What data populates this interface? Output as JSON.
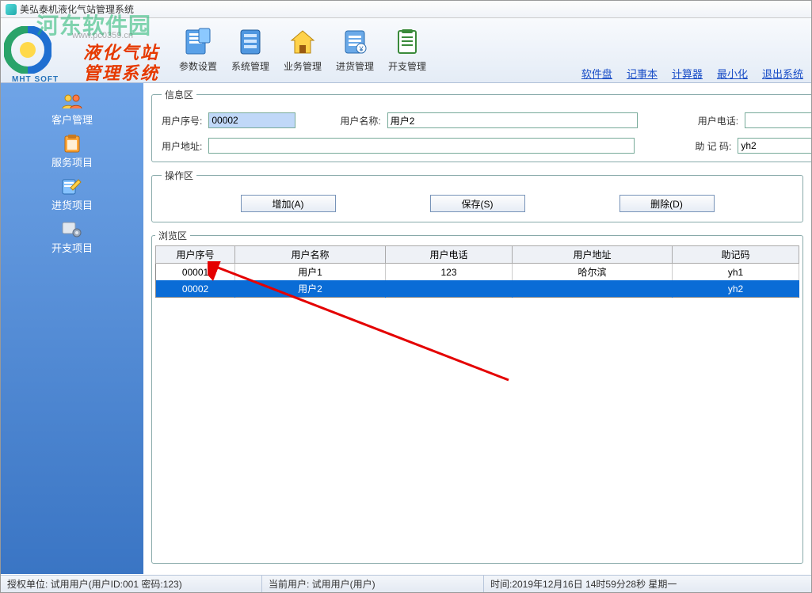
{
  "window": {
    "title": "美弘泰机液化气站管理系统"
  },
  "brand": {
    "line1": "液化气站",
    "line2": "管理系统",
    "mht": "MHT SOFT"
  },
  "watermark": {
    "big": "河东软件园",
    "url": "www.pc0359.cn"
  },
  "menu": [
    {
      "key": "params",
      "label": "参数设置"
    },
    {
      "key": "system",
      "label": "系统管理"
    },
    {
      "key": "biz",
      "label": "业务管理"
    },
    {
      "key": "stock",
      "label": "进货管理"
    },
    {
      "key": "expense",
      "label": "开支管理"
    }
  ],
  "links": [
    {
      "key": "disk",
      "label": "软件盘"
    },
    {
      "key": "note",
      "label": "记事本"
    },
    {
      "key": "calc",
      "label": "计算器"
    },
    {
      "key": "min",
      "label": "最小化"
    },
    {
      "key": "exit",
      "label": "退出系统"
    }
  ],
  "sidebar": [
    {
      "key": "cust",
      "label": "客户管理"
    },
    {
      "key": "svc",
      "label": "服务项目"
    },
    {
      "key": "stock",
      "label": "进货项目"
    },
    {
      "key": "exp",
      "label": "开支项目"
    }
  ],
  "info": {
    "legend": "信息区",
    "user_no_label": "用户序号:",
    "user_no": "00002",
    "user_name_label": "用户名称:",
    "user_name": "用户2",
    "user_phone_label": "用户电话:",
    "user_phone": "",
    "user_addr_label": "用户地址:",
    "user_addr": "",
    "mnemonic_label": "助 记 码:",
    "mnemonic": "yh2"
  },
  "ops": {
    "legend": "操作区",
    "add": "增加(A)",
    "save": "保存(S)",
    "del": "删除(D)"
  },
  "browse": {
    "legend": "浏览区",
    "columns": [
      "用户序号",
      "用户名称",
      "用户电话",
      "用户地址",
      "助记码"
    ],
    "rows": [
      {
        "no": "00001",
        "name": "用户1",
        "phone": "123",
        "addr": "哈尔滨",
        "mn": "yh1",
        "selected": false
      },
      {
        "no": "00002",
        "name": "用户2",
        "phone": "",
        "addr": "",
        "mn": "yh2",
        "selected": true
      }
    ]
  },
  "status": {
    "auth": "授权单位: 试用用户(用户ID:001 密码:123)",
    "current": "当前用户: 试用用户(用户)",
    "time": "时间:2019年12月16日 14时59分28秒 星期一"
  }
}
